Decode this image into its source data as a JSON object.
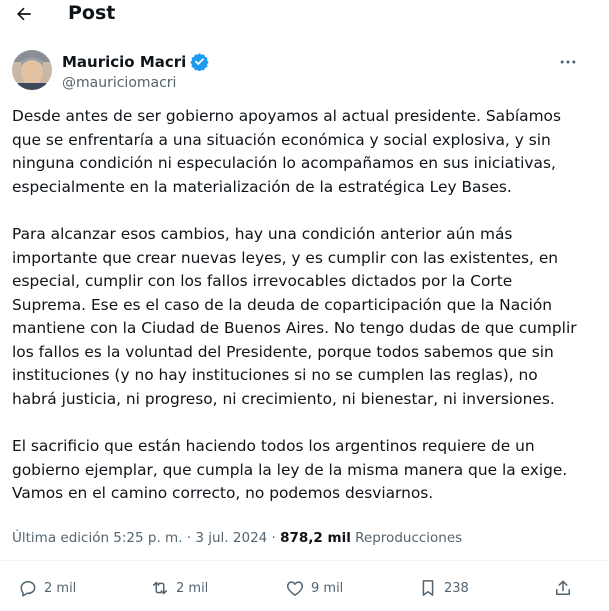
{
  "header": {
    "title": "Post"
  },
  "author": {
    "display_name": "Mauricio Macri",
    "handle": "@mauriciomacri",
    "verified": true,
    "verified_color": "#1d9bf0"
  },
  "tweet": {
    "paragraphs": [
      "Desde antes de ser gobierno apoyamos al actual presidente. Sabíamos que se enfrentaría a una situación económica y social explosiva, y sin ninguna condición ni especulación lo acompañamos en sus iniciativas, especialmente en la materialización de la estratégica Ley Bases.",
      "Para alcanzar esos cambios, hay una condición anterior aún más importante que crear nuevas leyes, y es cumplir con las existentes, en especial, cumplir con los fallos irrevocables dictados por la Corte Suprema. Ese es el caso de la deuda de coparticipación que la Nación mantiene con la Ciudad de Buenos Aires. No tengo dudas de que cumplir los fallos es la voluntad del Presidente, porque todos sabemos que sin instituciones (y no hay instituciones si no se cumplen las reglas), no habrá justicia, ni progreso, ni crecimiento, ni bienestar, ni inversiones.",
      "El sacrificio que están haciendo todos los argentinos requiere de un gobierno ejemplar, que cumpla la ley de la misma manera que la exige. Vamos en el camino correcto, no podemos desviarnos."
    ],
    "edited_label": "Última edición 5:25 p. m. · 3 jul. 2024 · ",
    "views_count": "878,2 mil",
    "views_label": " Reproducciones"
  },
  "actions": {
    "replies": "2 mil",
    "reposts": "2 mil",
    "likes": "9 mil",
    "bookmarks": "238"
  },
  "icons": {
    "back": "arrow-left-icon",
    "more": "more-dots-icon",
    "reply": "comment-icon",
    "repost": "repost-icon",
    "like": "heart-icon",
    "bookmark": "bookmark-icon",
    "share": "share-icon"
  }
}
